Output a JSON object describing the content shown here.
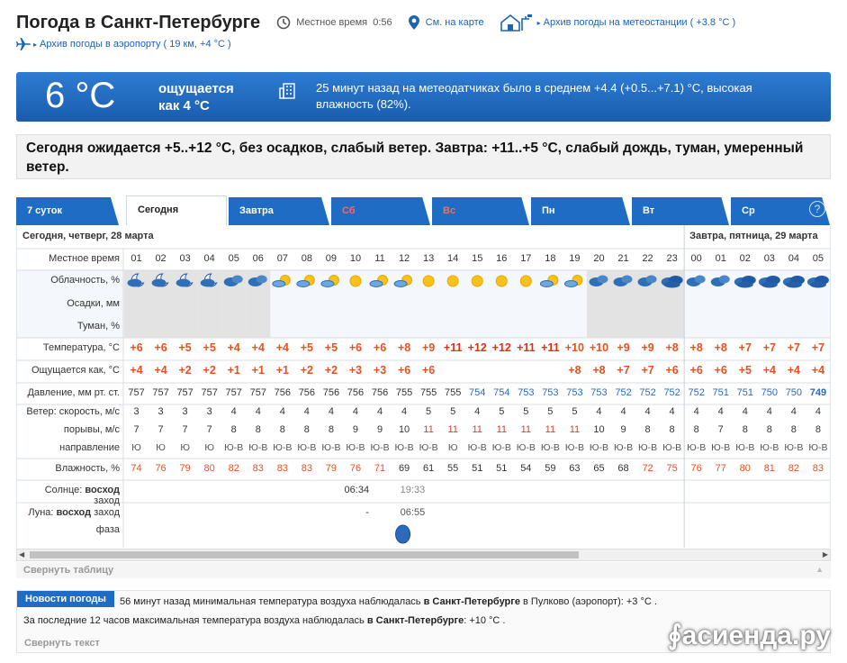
{
  "header": {
    "title": "Погода в Санкт-Петербурге",
    "local_time_label": "Местное время",
    "local_time": "0:56",
    "map_link": "См. на карте",
    "archive_station": "Архив погоды на метеостанции",
    "archive_station_temp": "( +3.8 °С )",
    "archive_airport": "Архив погоды в аэропорту",
    "archive_airport_note": "( 19 км, +4 °С )"
  },
  "now": {
    "temp": "6 °C",
    "feels1": "ощущается",
    "feels2": "как 4 °C",
    "meteo": "25 минут назад на метеодатчиках было в среднем +4.4 (+0.5...+7.1) °С, высокая влажность (82%)."
  },
  "forecast": "Сегодня ожидается +5..+12 °С, без осадков, слабый ветер. Завтра: +11..+5 °С, слабый дождь, туман, умеренный ветер.",
  "tabs": [
    {
      "label": "7 суток",
      "active": false,
      "weekend": false
    },
    {
      "label": "Сегодня",
      "active": true,
      "weekend": false
    },
    {
      "label": "Завтра",
      "active": false,
      "weekend": false
    },
    {
      "label": "Сб",
      "active": false,
      "weekend": true
    },
    {
      "label": "Вс",
      "active": false,
      "weekend": true
    },
    {
      "label": "Пн",
      "active": false,
      "weekend": false
    },
    {
      "label": "Вт",
      "active": false,
      "weekend": false
    },
    {
      "label": "Ср",
      "active": false,
      "weekend": false
    }
  ],
  "help": "?",
  "table": {
    "day1": "Сегодня, четверг, 28 марта",
    "day2": "Завтра, пятница, 29 марта",
    "labels": {
      "time": "Местное время",
      "cloud": "Облачность, %",
      "precip": "Осадки, мм",
      "fog": "Туман, %",
      "temp": "Температура, °С",
      "feels": "Ощущается как, °С",
      "pressure": "Давление, мм рт. ст.",
      "wind": "Ветер: скорость, м/с",
      "gust": "порывы, м/с",
      "dir": "направление",
      "humidity": "Влажность, %",
      "sun_a": "Солнце: ",
      "sun_b": "восход",
      "sun_c": " заход",
      "moon_a": "Луна: ",
      "moon_b": "восход",
      "moon_c": " заход",
      "phase": "фаза"
    },
    "hours": [
      "01",
      "02",
      "03",
      "04",
      "05",
      "06",
      "07",
      "08",
      "09",
      "10",
      "11",
      "12",
      "13",
      "14",
      "15",
      "16",
      "17",
      "18",
      "19",
      "20",
      "21",
      "22",
      "23",
      "00",
      "01",
      "02",
      "03",
      "04",
      "05"
    ],
    "cloud": [
      "night-partly",
      "night-partly",
      "night-partly",
      "night-partly",
      "night-cloudy",
      "night-cloudy",
      "partly",
      "partly",
      "partly",
      "sun",
      "partly",
      "partly",
      "sun",
      "sun",
      "sun",
      "sun",
      "sun",
      "partly",
      "partly",
      "night-cloudy",
      "night-cloudy",
      "night-cloudy",
      "night-overcast",
      "night-cloudy",
      "night-cloudy",
      "night-overcast",
      "night-overcast",
      "night-overcast",
      "night-overcast"
    ],
    "temp": [
      "+6",
      "+6",
      "+5",
      "+5",
      "+4",
      "+4",
      "+4",
      "+5",
      "+5",
      "+6",
      "+6",
      "+8",
      "+9",
      "+11",
      "+12",
      "+12",
      "+11",
      "+11",
      "+10",
      "+10",
      "+9",
      "+9",
      "+8",
      "+8",
      "+8",
      "+7",
      "+7",
      "+7",
      "+7"
    ],
    "feels": [
      "+4",
      "+4",
      "+2",
      "+2",
      "+1",
      "+1",
      "+1",
      "+2",
      "+2",
      "+3",
      "+3",
      "+6",
      "+6",
      "",
      "",
      "",
      "",
      "",
      "+8",
      "+8",
      "+7",
      "+7",
      "+6",
      "+6",
      "+6",
      "+5",
      "+4",
      "+4",
      "+4"
    ],
    "pressure": [
      "757",
      "757",
      "757",
      "757",
      "757",
      "757",
      "756",
      "756",
      "756",
      "756",
      "756",
      "755",
      "755",
      "755",
      "754",
      "754",
      "753",
      "753",
      "753",
      "753",
      "752",
      "752",
      "752",
      "752",
      "751",
      "751",
      "750",
      "750",
      "749"
    ],
    "wind": [
      "3",
      "3",
      "3",
      "3",
      "4",
      "4",
      "4",
      "4",
      "4",
      "4",
      "4",
      "4",
      "5",
      "5",
      "4",
      "5",
      "5",
      "5",
      "5",
      "4",
      "4",
      "4",
      "4",
      "4",
      "4",
      "4",
      "4",
      "4",
      "4"
    ],
    "gust": [
      "7",
      "7",
      "7",
      "7",
      "8",
      "8",
      "8",
      "8",
      "8",
      "9",
      "9",
      "10",
      "11",
      "11",
      "11",
      "11",
      "11",
      "11",
      "11",
      "10",
      "9",
      "8",
      "8",
      "8",
      "7",
      "8",
      "8",
      "8",
      "8"
    ],
    "dir": [
      "Ю",
      "Ю",
      "Ю",
      "Ю",
      "Ю-В",
      "Ю-В",
      "Ю-В",
      "Ю-В",
      "Ю-В",
      "Ю-В",
      "Ю-В",
      "Ю-В",
      "Ю-В",
      "Ю",
      "Ю-В",
      "Ю-В",
      "Ю-В",
      "Ю-В",
      "Ю-В",
      "Ю-В",
      "Ю-В",
      "Ю-В",
      "Ю-В",
      "Ю-В",
      "Ю-В",
      "Ю-В",
      "Ю-В",
      "Ю-В",
      "Ю-В"
    ],
    "humidity": [
      "74",
      "76",
      "79",
      "80",
      "82",
      "83",
      "83",
      "83",
      "79",
      "76",
      "71",
      "69",
      "61",
      "55",
      "51",
      "51",
      "54",
      "59",
      "63",
      "65",
      "68",
      "72",
      "75",
      "76",
      "77",
      "80",
      "81",
      "82",
      "83"
    ],
    "sunrise": "06:34",
    "sunset": "19:33",
    "moonrise": "-",
    "moonset": "06:55"
  },
  "colors": {
    "warm": "#e8501e",
    "hot": "#e0301a",
    "cold_text": "#333",
    "gust_strong": "#d83a2a",
    "humid": "#e8501e",
    "press_low": "#2a6bbd",
    "night_bg": "#e3e3e3",
    "tab": "#1f6cc5"
  },
  "collapse_table": "Свернуть таблицу",
  "news": {
    "badge": "Новости погоды",
    "l1_a": "56 минут назад минимальная температура воздуха наблюдалась ",
    "l1_b": "в Санкт-Петербурге",
    "l1_c": " в Пулково (аэропорт): +3 °С .",
    "l2_a": "За последние 12 часов максимальная температура воздуха наблюдалась ",
    "l2_b": "в Санкт-Петербурге",
    "l2_c": ": +10 °С .",
    "collapse": "Свернуть текст"
  },
  "watermark": "асиенда.ру"
}
